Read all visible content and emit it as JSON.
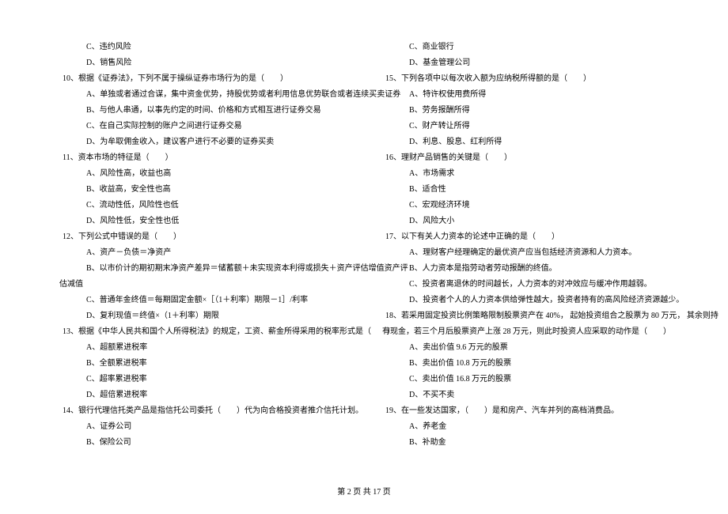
{
  "left": [
    {
      "cls": "opt",
      "t": "C、违约风险"
    },
    {
      "cls": "opt",
      "t": "D、销售风险"
    },
    {
      "cls": "qnum",
      "t": "10、根据《证券法》，下列不属于操纵证券市场行为的是（　　）"
    },
    {
      "cls": "opt",
      "t": "A、单独或者通过合谋，集中资金优势，持股优势或者利用信息优势联合或者连续买卖证券"
    },
    {
      "cls": "opt",
      "t": "B、与他人串通，以事先约定的时间、价格和方式相互进行证券交易"
    },
    {
      "cls": "opt",
      "t": "C、在自己实际控制的账户之间进行证券交易"
    },
    {
      "cls": "opt",
      "t": "D、为牟取佣金收入，建议客户进行不必要的证券买卖"
    },
    {
      "cls": "qnum",
      "t": "11、资本市场的特征是（　　）"
    },
    {
      "cls": "opt",
      "t": "A、风险性高，收益也高"
    },
    {
      "cls": "opt",
      "t": "B、收益高，安全性也高"
    },
    {
      "cls": "opt",
      "t": "C、流动性低，风险性也低"
    },
    {
      "cls": "opt",
      "t": "D、风险性低，安全性也低"
    },
    {
      "cls": "qnum",
      "t": "12、下列公式中错误的是（　　）"
    },
    {
      "cls": "opt",
      "t": "A、资产－负债＝净资产"
    },
    {
      "cls": "opt",
      "t": "B、以市价计的期初期末净资产差异＝储蓄额＋未实现资本利得或损失＋资产评估增值资产评"
    },
    {
      "cls": "noindent",
      "t": "估减值"
    },
    {
      "cls": "opt",
      "t": "C、普通年金终值＝每期固定金额×［（1＋利率）期限－1］/利率"
    },
    {
      "cls": "opt",
      "t": "D、复利现值＝终值×（1＋利率）期限"
    },
    {
      "cls": "qnum",
      "t": "13、根据《中华人民共和国个人所得税法》的规定，工资、薪金所得采用的税率形式是（　　）"
    },
    {
      "cls": "opt",
      "t": "A、超额累进税率"
    },
    {
      "cls": "opt",
      "t": "B、全额累进税率"
    },
    {
      "cls": "opt",
      "t": "C、超率累进税率"
    },
    {
      "cls": "opt",
      "t": "D、超倍累进税率"
    },
    {
      "cls": "qnum",
      "t": "14、银行代理信托类产品是指信托公司委托（　　）代为向合格投资者推介信托计划。"
    },
    {
      "cls": "opt",
      "t": "A、证券公司"
    },
    {
      "cls": "opt",
      "t": "B、保险公司"
    }
  ],
  "right": [
    {
      "cls": "opt",
      "t": "C、商业银行"
    },
    {
      "cls": "opt",
      "t": "D、基金管理公司"
    },
    {
      "cls": "qnum",
      "t": "15、下列各项中以每次收入额为应纳税所得额的是（　　）"
    },
    {
      "cls": "opt",
      "t": "A、特许权使用费所得"
    },
    {
      "cls": "opt",
      "t": "B、劳务报酬所得"
    },
    {
      "cls": "opt",
      "t": "C、财产转让所得"
    },
    {
      "cls": "opt",
      "t": "D、利息、股息、红利所得"
    },
    {
      "cls": "qnum",
      "t": "16、理财产品销售的关键是（　　）"
    },
    {
      "cls": "opt",
      "t": "A、市场需求"
    },
    {
      "cls": "opt",
      "t": "B、适合性"
    },
    {
      "cls": "opt",
      "t": "C、宏观经济环境"
    },
    {
      "cls": "opt",
      "t": "D、风险大小"
    },
    {
      "cls": "qnum",
      "t": "17、以下有关人力资本的论述中正确的是（　　）"
    },
    {
      "cls": "opt",
      "t": "A、理财客户经理确定的最优资产应当包括经济资源和人力资本。"
    },
    {
      "cls": "opt",
      "t": "B、人力资本是指劳动者劳动报酬的终值。"
    },
    {
      "cls": "opt",
      "t": "C、投资者离退休的时间越长，人力资本的对冲效应与缓冲作用越弱。"
    },
    {
      "cls": "opt",
      "t": "D、投资者个人的人力资本供给弹性越大，投资者持有的高风险经济资源越少。"
    },
    {
      "cls": "qnum",
      "t": "18、若采用固定投资比例策略限制股票资产在 40%， 起始投资组合之股票为 80 万元， 其余则持"
    },
    {
      "cls": "noindent",
      "t": "有现金，若三个月后股票资产上涨 28 万元，则此时投资人应采取的动作是（　　）"
    },
    {
      "cls": "opt",
      "t": "A、卖出价值 9.6 万元的股票"
    },
    {
      "cls": "opt",
      "t": "B、卖出价值 10.8 万元的股票"
    },
    {
      "cls": "opt",
      "t": "C、卖出价值 16.8 万元的股票"
    },
    {
      "cls": "opt",
      "t": "D、不买不卖"
    },
    {
      "cls": "qnum",
      "t": "19、在一些发达国家，（　　）是和房产、汽车并列的高档消费品。"
    },
    {
      "cls": "opt",
      "t": "A、养老金"
    },
    {
      "cls": "opt",
      "t": "B、补助金"
    }
  ],
  "footer": "第 2 页 共 17 页"
}
